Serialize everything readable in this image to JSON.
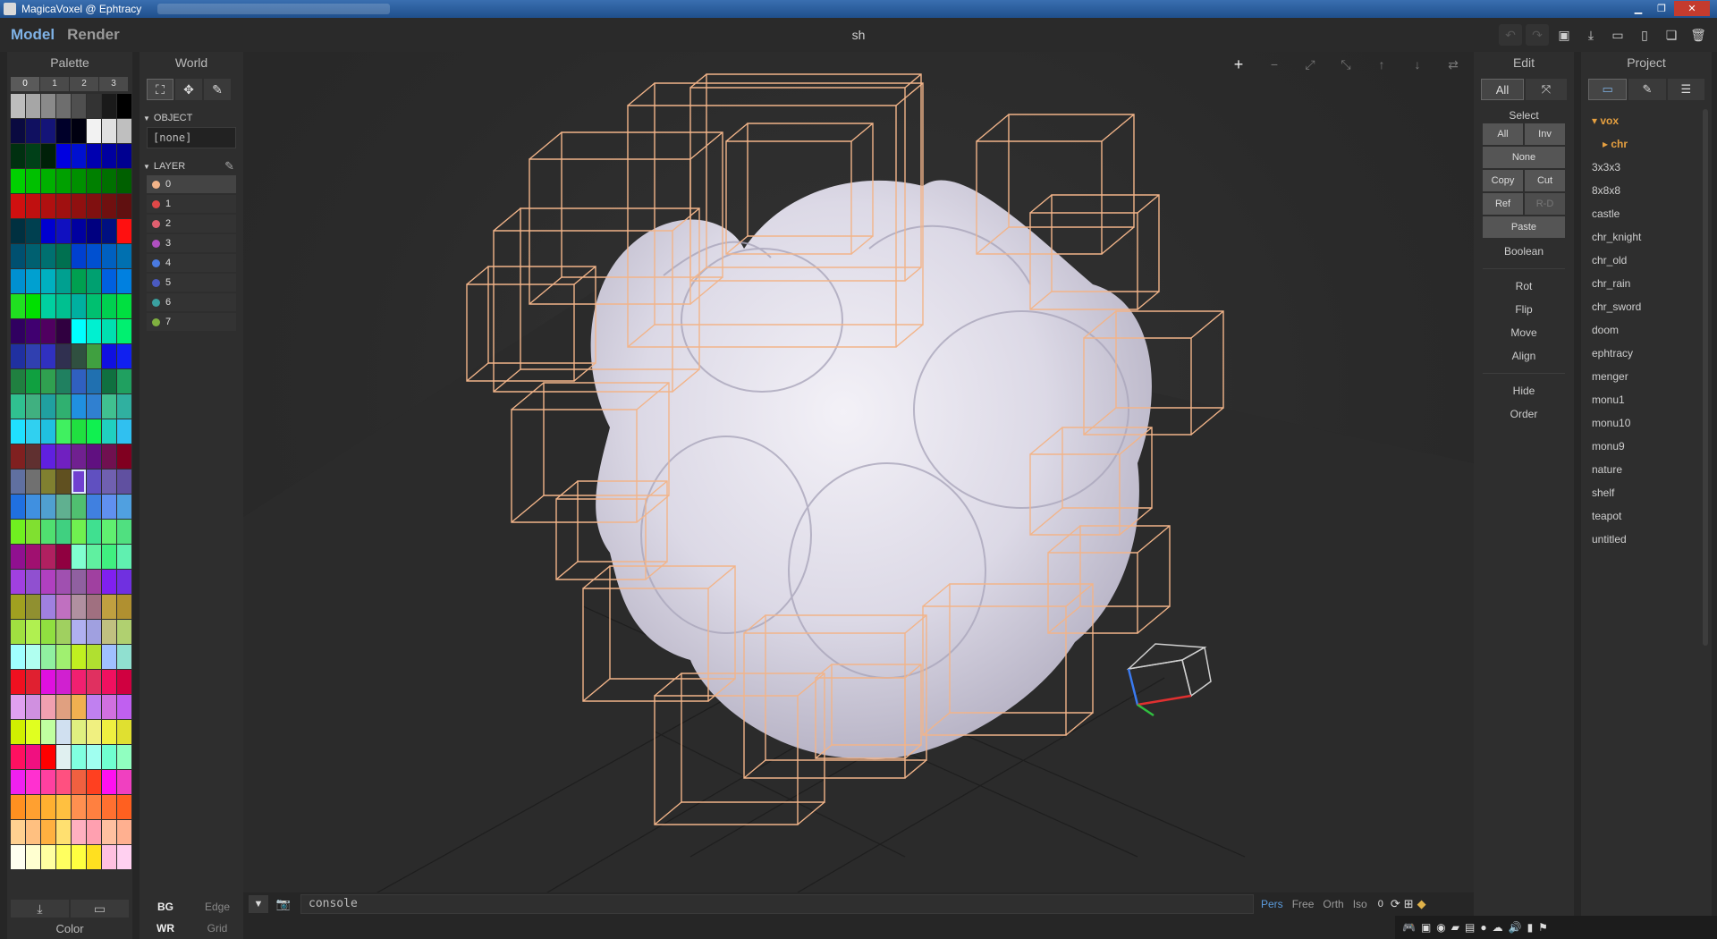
{
  "window": {
    "title": "MagicaVoxel @ Ephtracy"
  },
  "topbar": {
    "modes": [
      "Model",
      "Render"
    ],
    "filename": "sh"
  },
  "palette": {
    "title": "Palette",
    "tabs": [
      "0",
      "1",
      "2",
      "3"
    ],
    "footer_label": "Color",
    "selected_index": 124,
    "colors": [
      "#bdbdbd",
      "#a6a6a6",
      "#8a8a8a",
      "#6e6e6e",
      "#4f4f4f",
      "#333333",
      "#1a1a1a",
      "#000000",
      "#0a0a40",
      "#101060",
      "#141478",
      "#00002a",
      "#000010",
      "#f2f2f2",
      "#e0e0e0",
      "#bfbfbf",
      "#003010",
      "#004018",
      "#002008",
      "#0000e0",
      "#0010d0",
      "#0000b0",
      "#0000a0",
      "#000090",
      "#00d000",
      "#00c000",
      "#00b000",
      "#00a000",
      "#009000",
      "#008000",
      "#007000",
      "#006000",
      "#d01010",
      "#c01010",
      "#b01010",
      "#a01010",
      "#901010",
      "#801010",
      "#701010",
      "#601010",
      "#003040",
      "#004050",
      "#0000d0",
      "#1010c0",
      "#0000a0",
      "#000080",
      "#001080",
      "#ff1010",
      "#005070",
      "#006070",
      "#007070",
      "#007050",
      "#0040d0",
      "#0050d0",
      "#0060c0",
      "#0070b0",
      "#0090d0",
      "#00a0d0",
      "#00b0c0",
      "#00a090",
      "#00a050",
      "#00a070",
      "#0060e0",
      "#0080e0",
      "#20e020",
      "#00e000",
      "#00d0a0",
      "#00c090",
      "#00b0a0",
      "#00c070",
      "#00d050",
      "#00e040",
      "#300060",
      "#400070",
      "#500060",
      "#300040",
      "#00ffff",
      "#00f0d0",
      "#00e0b0",
      "#00f070",
      "#2030a0",
      "#3040b0",
      "#3030c0",
      "#303050",
      "#305040",
      "#40a040",
      "#1010e0",
      "#1020f0",
      "#208040",
      "#10a040",
      "#30a050",
      "#208060",
      "#3060c0",
      "#2070b0",
      "#107040",
      "#20a060",
      "#30c090",
      "#40b080",
      "#20a0a0",
      "#30b070",
      "#2090e0",
      "#3080d0",
      "#40c090",
      "#30b0a0",
      "#20e0ff",
      "#30d0f0",
      "#20c0e0",
      "#40f060",
      "#20e040",
      "#10f050",
      "#20d0c0",
      "#30c0f0",
      "#802020",
      "#603030",
      "#6020e0",
      "#7020c0",
      "#702090",
      "#601080",
      "#701050",
      "#800020",
      "#6070a0",
      "#707070",
      "#808030",
      "#605020",
      "#7040d0",
      "#6050c0",
      "#7060b0",
      "#6050a0",
      "#2070e0",
      "#4090e0",
      "#50a0d0",
      "#60b090",
      "#50c070",
      "#4080e0",
      "#6090f0",
      "#50a0e0",
      "#70f020",
      "#80e030",
      "#50e070",
      "#40d080",
      "#70f050",
      "#40e090",
      "#60f070",
      "#50e080",
      "#901090",
      "#a01070",
      "#b02060",
      "#900040",
      "#80ffd0",
      "#60f0a0",
      "#40f080",
      "#60f0b0",
      "#a040e0",
      "#9050d0",
      "#b040c0",
      "#a050b0",
      "#9060a0",
      "#a040a0",
      "#8020f0",
      "#7030e0",
      "#a0a020",
      "#909030",
      "#a080e0",
      "#c070c0",
      "#b090a0",
      "#a07080",
      "#c0a040",
      "#b09030",
      "#a0e040",
      "#b0f050",
      "#90e040",
      "#a0d060",
      "#b0b0f0",
      "#a0a0e0",
      "#c0c080",
      "#b0d070",
      "#a0ffff",
      "#b0fff0",
      "#90f0a0",
      "#a0f070",
      "#c0f020",
      "#b0e030",
      "#a0c0ff",
      "#90e0d0",
      "#f01020",
      "#e02030",
      "#e010e0",
      "#d020d0",
      "#f02070",
      "#e03060",
      "#f01060",
      "#d00040",
      "#e0a0f0",
      "#d090e0",
      "#f0a0b0",
      "#e0a080",
      "#f0b050",
      "#c080f0",
      "#d070e0",
      "#c060f0",
      "#d0f000",
      "#e0ff20",
      "#c0ffa0",
      "#d0e0f0",
      "#e0f080",
      "#f0f080",
      "#f0f040",
      "#e0e030",
      "#ff1060",
      "#f01080",
      "#ff0000",
      "#e0f0f0",
      "#80ffe0",
      "#a0fff0",
      "#70ffd0",
      "#90ffc0",
      "#f020f0",
      "#ff30d0",
      "#ff40a0",
      "#ff5080",
      "#f06040",
      "#ff4020",
      "#ff10f0",
      "#f040c0",
      "#ff9020",
      "#ffa030",
      "#ffb030",
      "#ffc040",
      "#ff9050",
      "#ff8040",
      "#ff7030",
      "#ff6020",
      "#ffd090",
      "#ffc080",
      "#ffb040",
      "#ffe070",
      "#ffb0c0",
      "#ffa0b0",
      "#ffc0a0",
      "#ffb090",
      "#fffff0",
      "#ffffd0",
      "#ffffa0",
      "#ffff60",
      "#ffff40",
      "#ffe020",
      "#ffc0e0",
      "#ffd0f0"
    ]
  },
  "world": {
    "title": "World",
    "tools": [
      "select-box-icon",
      "move-icon",
      "eyedropper-icon"
    ],
    "object_section": "OBJECT",
    "object_value": "[none]",
    "layer_section": "LAYER",
    "layers": [
      {
        "label": "0",
        "color": "#f2b489"
      },
      {
        "label": "1",
        "color": "#e04848"
      },
      {
        "label": "2",
        "color": "#e06070"
      },
      {
        "label": "3",
        "color": "#b050c0"
      },
      {
        "label": "4",
        "color": "#4a7ae0"
      },
      {
        "label": "5",
        "color": "#4a5ac0"
      },
      {
        "label": "6",
        "color": "#3aa0a0"
      },
      {
        "label": "7",
        "color": "#80b040"
      }
    ],
    "bottom": [
      [
        "BG",
        "Edge"
      ],
      [
        "WR",
        "Grid"
      ]
    ]
  },
  "viewport": {
    "wire_color": "#f2b489",
    "toolbar": [
      "+",
      "−",
      "⤢",
      "⤡",
      "↑",
      "↓",
      "⇄"
    ]
  },
  "statusbar": {
    "console": "console",
    "views": [
      "Pers",
      "Free",
      "Orth",
      "Iso"
    ],
    "number": "0"
  },
  "edit": {
    "title": "Edit",
    "top": [
      "All",
      "⤧"
    ],
    "select_label": "Select",
    "select_rows": [
      [
        "All",
        "Inv"
      ],
      [
        "None"
      ],
      [
        "Copy",
        "Cut"
      ],
      [
        "Ref",
        "R-D"
      ],
      [
        "Paste"
      ]
    ],
    "boolean": "Boolean",
    "transforms": [
      "Rot",
      "Flip",
      "Move",
      "Align"
    ],
    "extras": [
      "Hide",
      "Order"
    ]
  },
  "project": {
    "title": "Project",
    "root": "vox",
    "subfolder": "chr",
    "files": [
      "3x3x3",
      "8x8x8",
      "castle",
      "chr_knight",
      "chr_old",
      "chr_rain",
      "chr_sword",
      "doom",
      "ephtracy",
      "menger",
      "monu1",
      "monu10",
      "monu9",
      "nature",
      "shelf",
      "teapot",
      "untitled"
    ]
  }
}
